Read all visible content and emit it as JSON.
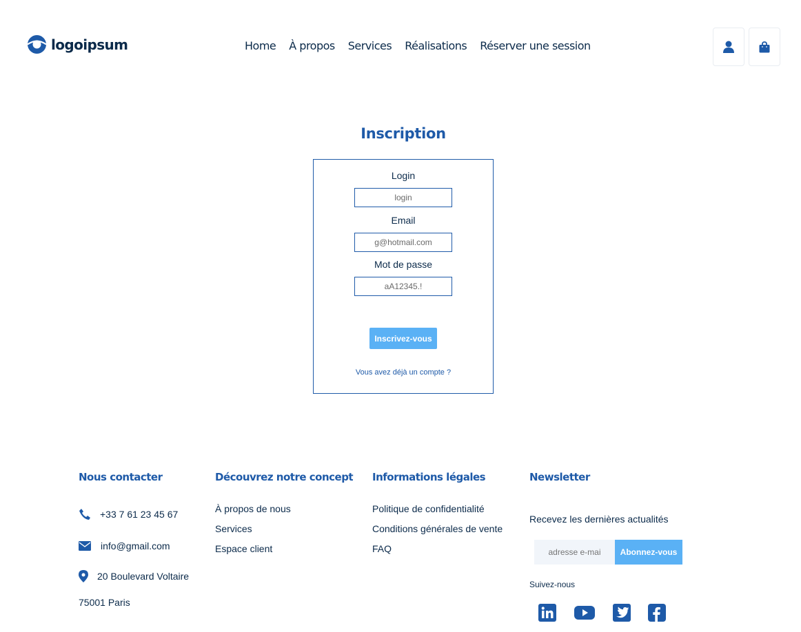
{
  "brand": {
    "logo_text": "logoipsum",
    "accent": "#1e5aa8",
    "button_color": "#5ab1f5"
  },
  "nav": {
    "items": [
      {
        "label": "Home"
      },
      {
        "label": "À propos"
      },
      {
        "label": "Services"
      },
      {
        "label": "Réalisations"
      },
      {
        "label": "Réserver une session"
      }
    ]
  },
  "header_icons": {
    "account": "user-icon",
    "cart": "shopping-bag-icon"
  },
  "form": {
    "title": "Inscription",
    "login_label": "Login",
    "login_value": "login",
    "email_label": "Email",
    "email_value": "g@hotmail.com",
    "password_label": "Mot de passe",
    "password_value": "aA12345.!",
    "submit_label": "Inscrivez-vous",
    "login_link": "Vous avez déjà un compte ?"
  },
  "footer": {
    "contact": {
      "heading": "Nous contacter",
      "phone": "+33 7 61 23 45 67",
      "email": "info@gmail.com",
      "address_line1": "20 Boulevard Voltaire",
      "address_line2": "75001 Paris"
    },
    "concept": {
      "heading": "Découvrez notre concept",
      "links": [
        "À propos de nous",
        "Services",
        "Espace client"
      ]
    },
    "legal": {
      "heading": "Informations légales",
      "links": [
        "Politique de confidentialité",
        "Conditions générales de vente",
        "FAQ"
      ]
    },
    "newsletter": {
      "heading": "Newsletter",
      "text": "Recevez les dernières actualités",
      "input_placeholder": "adresse e-mai",
      "button_label": "Abonnez-vous",
      "follow_label": "Suivez-nous",
      "socials": [
        "linkedin-icon",
        "youtube-icon",
        "twitter-icon",
        "facebook-icon"
      ]
    }
  }
}
